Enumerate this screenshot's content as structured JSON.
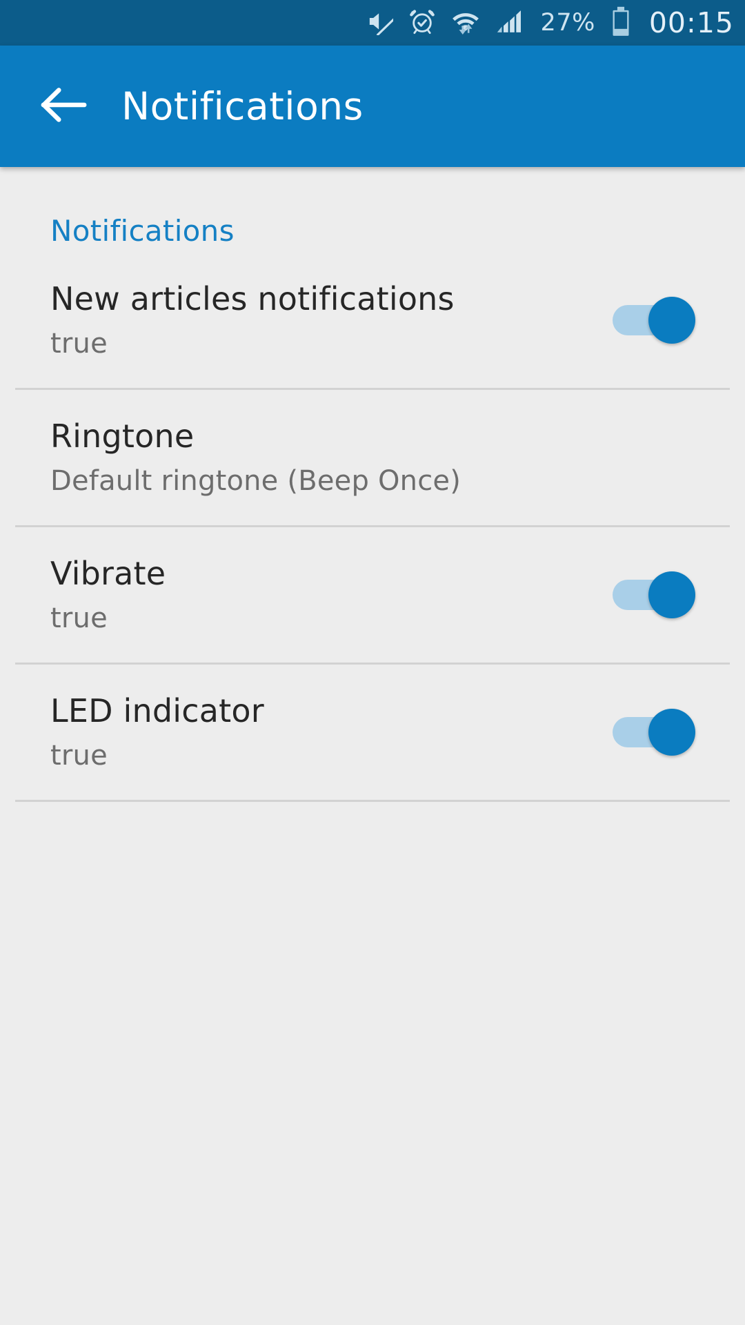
{
  "status_bar": {
    "background": "#0c5c8a",
    "icons": [
      {
        "name": "mute-icon",
        "label": "Sound muted"
      },
      {
        "name": "alarm-icon",
        "label": "Alarm set"
      },
      {
        "name": "wifi-data-icon",
        "label": "Wi-Fi connected with data activity"
      },
      {
        "name": "signal-bars-icon",
        "label": "Cellular signal"
      }
    ],
    "battery_percent": "27%",
    "battery_icon": "battery-low-icon",
    "clock": "00:15"
  },
  "app_bar": {
    "background": "#0b7cc1",
    "back_icon": "arrow-left-icon",
    "title": "Notifications"
  },
  "content": {
    "background": "#ededed",
    "section_header": "Notifications",
    "section_header_color": "#1580c4",
    "preferences": [
      {
        "key": "new-articles-notifications",
        "title": "New articles notifications",
        "summary": "true",
        "has_switch": true,
        "switch_state": "on"
      },
      {
        "key": "ringtone",
        "title": "Ringtone",
        "summary": "Default ringtone (Beep Once)",
        "has_switch": false,
        "switch_state": null
      },
      {
        "key": "vibrate",
        "title": "Vibrate",
        "summary": "true",
        "has_switch": true,
        "switch_state": "on"
      },
      {
        "key": "led-indicator",
        "title": "LED indicator",
        "summary": "true",
        "has_switch": true,
        "switch_state": "on"
      }
    ]
  },
  "colors": {
    "status_bar": "#0c5c8a",
    "app_bar": "#0b7cc1",
    "accent": "#1580c4",
    "switch_thumb_on": "#0a7cc0",
    "switch_track_on": "#a9cfe8",
    "background": "#ededed",
    "divider": "#d2d2d2",
    "title_text": "#262626",
    "summary_text": "#6d6d6d"
  }
}
